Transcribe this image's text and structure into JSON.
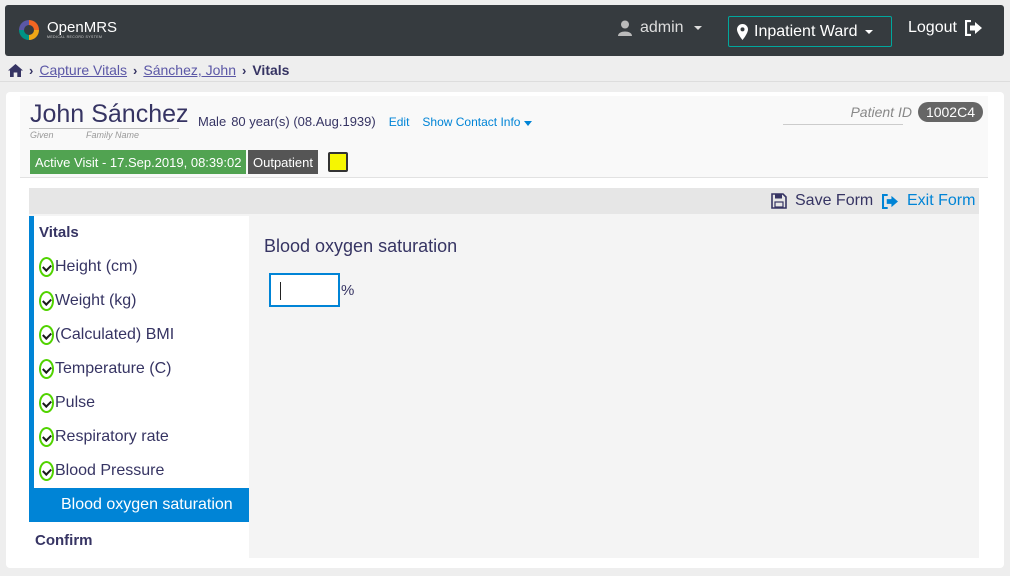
{
  "header": {
    "logo_text": "OpenMRS",
    "logo_tagline": "MEDICAL RECORD SYSTEM",
    "user": "admin",
    "location": "Inpatient Ward",
    "logout": "Logout"
  },
  "breadcrumb": {
    "items": [
      "Capture Vitals",
      "Sánchez, John"
    ],
    "current": "Vitals"
  },
  "patient": {
    "given": "John",
    "family": "Sánchez",
    "given_label": "Given",
    "family_label": "Family Name",
    "gender": "Male",
    "age": "80 year(s) (08.Aug.1939)",
    "edit": "Edit",
    "show_contact": "Show Contact Info",
    "id_label": "Patient ID",
    "id": "1002C4",
    "visit_badge": "Active Visit - 17.Sep.2019, 08:39:02",
    "type_badge": "Outpatient"
  },
  "toolbar": {
    "save": "Save Form",
    "exit": "Exit Form"
  },
  "sidebar": {
    "section": "Vitals",
    "items": [
      "Height (cm)",
      "Weight (kg)",
      "(Calculated) BMI",
      "Temperature (C)",
      "Pulse",
      "Respiratory rate",
      "Blood Pressure"
    ],
    "active": "Blood oxygen saturation",
    "confirm": "Confirm"
  },
  "question": {
    "title": "Blood oxygen saturation",
    "value": "",
    "unit": "%"
  },
  "colors": {
    "header_bg": "#363b3f",
    "accent_blue": "#0084d6",
    "visit_green": "#51a351",
    "check_green": "#51d300",
    "text_primary": "#363463"
  }
}
